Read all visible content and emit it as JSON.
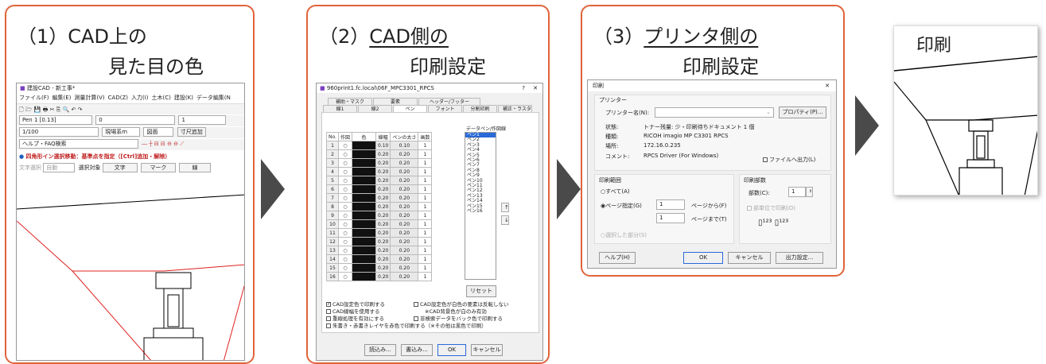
{
  "panel1": {
    "title_line1": "（1）CAD上の",
    "title_line2": "見た目の色",
    "app": {
      "window_title": "建設CAD - 新工事*",
      "menu": [
        "ファイル(F)",
        "編集(E)",
        "測量計算(V)",
        "CAD(Z)",
        "入力(I)",
        "土木(C)",
        "建設(K)",
        "データ編集(N"
      ],
      "pen_select": "Pen 1 [0.13]",
      "layer_select": "0",
      "layer2_select": "1",
      "scale_select": "1/100",
      "unit_select": "現場系m",
      "view_select": "図面",
      "dim_button": "寸尺追加",
      "help_search": "ヘルプ・FAQ検索",
      "status": "四角形イン選択移動：基準点を指定（[Ctrl]追加・解除）",
      "text_select_label": "文字選択",
      "auto_select": "自動",
      "target_label": "選択対象",
      "text_button": "文字",
      "mark_button": "マーク",
      "line_button": "線"
    }
  },
  "panel2": {
    "title_line1": "（2）",
    "title_line1b": "CAD側の",
    "title_line2": "印刷設定",
    "dialog": {
      "title": "960print1.fc.local\\06F_MPC3301_RPCS",
      "help_btn": "?",
      "close_btn": "✕",
      "tabs_row1": [
        "補助・マスク",
        "要素",
        "ヘッダー/フッター"
      ],
      "tabs_row2": [
        "線1",
        "線2",
        "ペン",
        "フォント",
        "分割印刷",
        "補正・ラスタ"
      ],
      "pen_list_label": "データペン/作図線",
      "headers": [
        "No.",
        "作図",
        "色",
        "線幅",
        "ペンの太さ",
        "画数"
      ],
      "rows": [
        [
          "1",
          "○",
          "0.10",
          "0.10",
          "1"
        ],
        [
          "2",
          "○",
          "0.20",
          "0.20",
          "1"
        ],
        [
          "3",
          "○",
          "0.20",
          "0.20",
          "1"
        ],
        [
          "4",
          "○",
          "0.20",
          "0.20",
          "1"
        ],
        [
          "5",
          "○",
          "0.20",
          "0.20",
          "1"
        ],
        [
          "6",
          "○",
          "0.20",
          "0.20",
          "1"
        ],
        [
          "7",
          "○",
          "0.20",
          "0.20",
          "1"
        ],
        [
          "8",
          "○",
          "0.20",
          "0.20",
          "1"
        ],
        [
          "9",
          "○",
          "0.20",
          "0.20",
          "1"
        ],
        [
          "10",
          "○",
          "0.20",
          "0.20",
          "1"
        ],
        [
          "11",
          "○",
          "0.20",
          "0.20",
          "1"
        ],
        [
          "12",
          "○",
          "0.20",
          "0.20",
          "1"
        ],
        [
          "13",
          "○",
          "0.20",
          "0.20",
          "1"
        ],
        [
          "14",
          "○",
          "0.20",
          "0.20",
          "1"
        ],
        [
          "15",
          "○",
          "0.20",
          "0.20",
          "1"
        ],
        [
          "16",
          "○",
          "0.20",
          "0.20",
          "1"
        ]
      ],
      "pens": [
        "ペン1",
        "ペン2",
        "ペン3",
        "ペン4",
        "ペン5",
        "ペン6",
        "ペン7",
        "ペン8",
        "ペン9",
        "ペン10",
        "ペン11",
        "ペン12",
        "ペン13",
        "ペン14",
        "ペン15",
        "ペン16"
      ],
      "reset_btn": "リセット",
      "checks": [
        "CAD設定色で印刷する",
        "CAD線幅を使用する",
        "重線処理を有効にする",
        "朱書き・赤書きレイヤを赤色で印刷する（※その他は黒色で印刷）"
      ],
      "checks_right": [
        "CAD設定色が白色の要素は反転しない",
        "※CAD背景色が白のみ有効",
        "非検索データをバック色で印刷する"
      ],
      "load_btn": "読込み...",
      "save_btn": "書込み...",
      "ok_btn": "OK",
      "cancel_btn": "キャンセル"
    }
  },
  "panel3": {
    "title_line1": "（3）",
    "title_line1b": "プリンタ側の",
    "title_line2": "印刷設定",
    "dialog": {
      "title": "印刷",
      "close_btn": "✕",
      "printer_group": "プリンター",
      "printer_name_label": "プリンター名(N):",
      "properties_btn": "プロパティ(P)...",
      "status_label": "状態:",
      "status_value": "トナー残量: 少・印刷待ちドキュメント 1 個",
      "type_label": "種類:",
      "type_value": "RICOH imagio MP C3301 RPCS",
      "where_label": "場所:",
      "where_value": "172.16.0.235",
      "comment_label": "コメント:",
      "comment_value": "RPCS Driver (For Windows)",
      "file_output": "ファイルへ出力(L)",
      "range_group": "印刷範囲",
      "all_label": "すべて(A)",
      "page_label": "ページ指定(G)",
      "page_from": "1",
      "page_from_label": "ページから(F)",
      "page_to": "1",
      "page_to_label": "ページまで(T)",
      "selection_label": "選択した部分(S)",
      "copies_group": "印刷部数",
      "copies_label": "部数(C):",
      "copies_value": "1",
      "collate_label": "部単位で印刷(O)",
      "help_btn": "ヘルプ(H)",
      "ok_btn": "OK",
      "cancel_btn": "キャンセル",
      "output_btn": "出力設定..."
    }
  },
  "panel4": {
    "title": "印刷"
  },
  "colors": {
    "accent_border": "#e0633a",
    "arrow": "#4a4a4a",
    "red_line": "#e02020"
  }
}
